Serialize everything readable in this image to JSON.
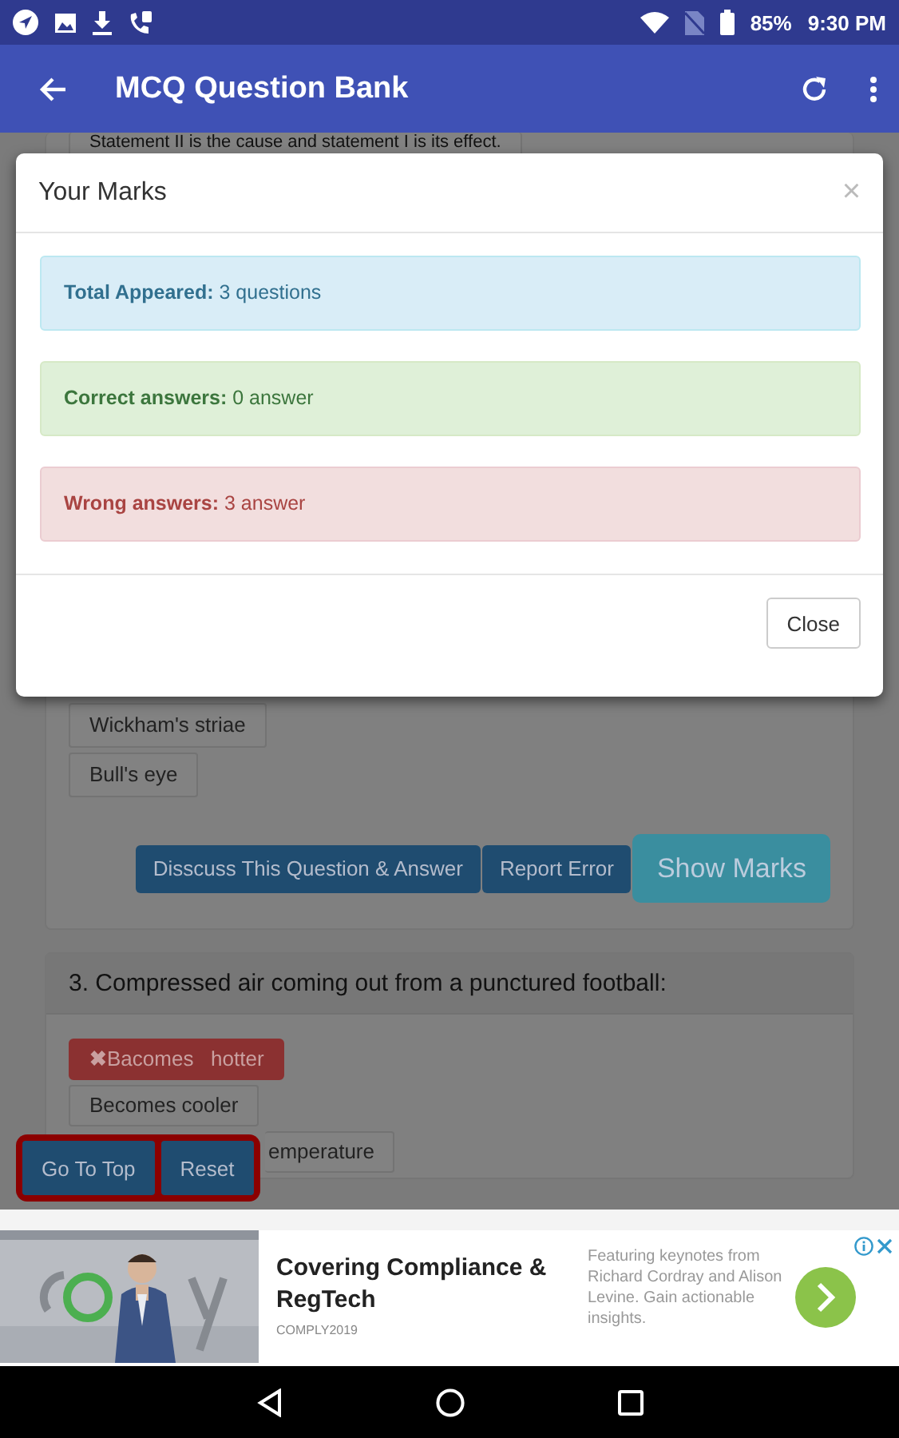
{
  "status_bar": {
    "battery": "85%",
    "time": "9:30 PM"
  },
  "app_bar": {
    "title": "MCQ Question Bank"
  },
  "page": {
    "cut_option": {
      "text": "Statement II is the cause and statement I is its effect."
    },
    "question_2": {
      "options": [
        {
          "text": "Wickham's striae"
        },
        {
          "text": "Bull's eye"
        }
      ],
      "buttons": [
        {
          "kind": "dark",
          "label": "Disscuss This Question & Answer"
        },
        {
          "kind": "dark",
          "label": "Report Error"
        },
        {
          "kind": "large",
          "label": "Show Marks"
        }
      ]
    },
    "question_3": {
      "title": "3. Compressed air coming out from a punctured football:",
      "options": [
        {
          "kind": "plain",
          "selected": true,
          "mark": "✖",
          "text": "Bacomes   hotter"
        },
        {
          "kind": "plain",
          "selected": false,
          "text": "Becomes cooler"
        },
        {
          "kind": "covered",
          "selected": false,
          "text": "emperature"
        }
      ]
    }
  },
  "floating_buttons": [
    "Go To Top",
    "Reset"
  ],
  "modal": {
    "title": "Your Marks",
    "close_icon": "×",
    "alerts": [
      {
        "kind": "info",
        "text": "**Total Appeared:** 3 questions"
      },
      {
        "kind": "success",
        "text": "**Correct answers:** 0 answer"
      },
      {
        "kind": "danger",
        "text": "**Wrong answers:** 3 answer"
      }
    ],
    "close_button": "Close"
  },
  "ad": {
    "title": "Covering Compliance & RegTech",
    "source": "COMPLY2019",
    "description": "Featuring keynotes from Richard Cordray and Alison Levine. Gain actionable insights."
  }
}
